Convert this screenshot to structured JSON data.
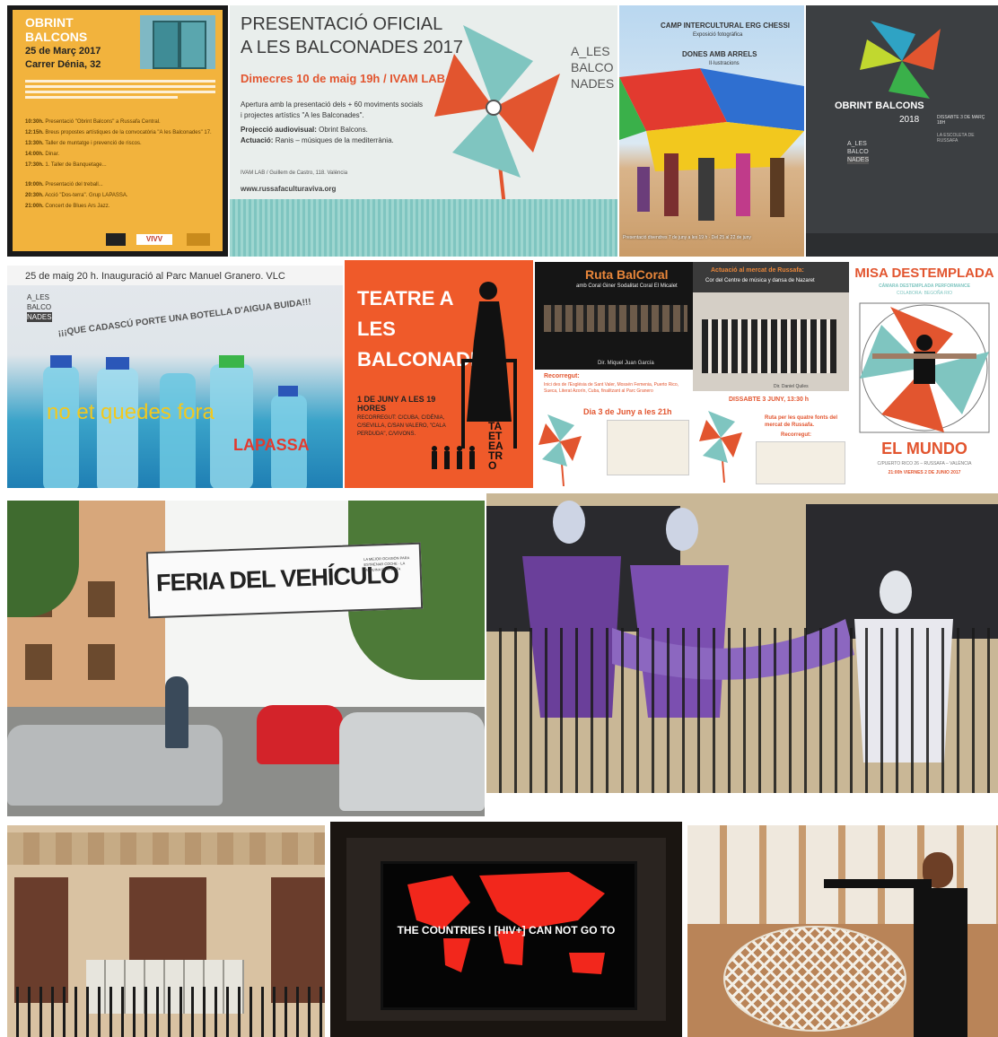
{
  "poster1": {
    "title": "OBRINT BALCONS",
    "date": "25 de Març 2017",
    "address": "Carrer Dénia, 32",
    "schedule": [
      {
        "time": "10:30h.",
        "text": "Presentació \"Obrint Balcons\" a Russafa Central."
      },
      {
        "time": "12:15h.",
        "text": "Breus propostes artístiques de la convocatòria \"A les Balconades\" 17."
      },
      {
        "time": "13:30h.",
        "text": "Taller de muntatge i prevenció de riscos."
      },
      {
        "time": "14:00h.",
        "text": "Dinar."
      },
      {
        "time": "17:30h.",
        "text": "1. Taller de Banquetage..."
      },
      {
        "time": "19:00h.",
        "text": "Presentació del treball..."
      },
      {
        "time": "20:30h.",
        "text": "Acció \"Dos-terra\". Grup LAPASSA."
      },
      {
        "time": "21:00h.",
        "text": "Concert de Blues Ars Jazz."
      }
    ],
    "logo_a": "VIVV"
  },
  "poster2": {
    "title_line1": "PRESENTACIÓ OFICIAL",
    "title_line2": "A LES BALCONADES 2017",
    "date_line": "Dimecres 10 de maig 19h / IVAM LAB",
    "body1": "Apertura amb la presentació dels + 60 moviments socials",
    "body2": "i projectes artístics \"A les Balconades\".",
    "proj_label": "Projecció audiovisual:",
    "proj_value": "Obrint Balcons.",
    "act_label": "Actuació:",
    "act_value": "Ranis – músiques de la mediterrània.",
    "venue": "IVAM LAB / Guillem de Castro, 118. València",
    "url": "www.russafaculturaviva.org",
    "brand": [
      "A_LES",
      "BALCO",
      "NADES"
    ]
  },
  "poster3": {
    "title": "CAMP INTERCULTURAL ERG CHESSI",
    "subtitle": "Exposició fotogràfica",
    "title2": "DONES AMB ARRELS",
    "subtitle2": "Il·lustracions",
    "footer": "Presentació divendres 7 de juny a les 19 h · Del 25 al 22 de juny"
  },
  "poster4": {
    "title": "OBRINT BALCONS",
    "year": "2018",
    "brand": [
      "A_LES",
      "BALCO",
      "NADES"
    ],
    "info": "DISSABTE 3 DE MARÇ 18H",
    "place": "LA ESCOLETA DE RUSSAFA"
  },
  "poster5": {
    "header": "25 de maig 20 h. Inauguració al Parc Manuel Granero. VLC",
    "brand": [
      "A_LES",
      "BALCO",
      "NADES"
    ],
    "slogan": "¡¡¡QUE CADASCÚ PORTE UNA BOTELLA D'AIGUA BUIDA!!!",
    "big": "no et quedes fora",
    "group": "LAPASSA"
  },
  "poster6": {
    "title": "TEATRE A LES BALCONADES",
    "date": "1 DE JUNY A LES 19 HORES",
    "route": "RECORREGUT: C/CUBA, C/DÉNIA, C/SEVILLA, C/SAN VALERO, \"CALA PERDUDA\", C/VIVONS.",
    "logo": "TAETEATRO"
  },
  "poster7": {
    "title": "Ruta BalCoral",
    "subtitle": "amb Coral Giner Sodalitat Coral El Micalet",
    "director": "Dir. Miquel Juan García",
    "route_label": "Recorregut:",
    "route_text": "Inici des de l'Església de Sant Valer, Mossén Femenia, Puerto Rico, Sueca, Literat Azorín, Cuba, finalitzant al Parc Granero",
    "date": "Dia 3 de Juny a les 21h"
  },
  "poster8": {
    "title": "Actuació al mercat de Russafa:",
    "subtitle": "Cor del Centre de música y dansa de Nazaret",
    "director": "Dir. Daniel Quiles",
    "date": "DISSABTE 3 JUNY, 13:30 h",
    "route": "Ruta per les quatre fonts del mercat de Russafa.",
    "route_label": "Recorregut:"
  },
  "poster9": {
    "title": "MISA DESTEMPLADA",
    "subtitle": "CÁMARA DESTEMPLADA PERFORMANCE",
    "collab": "COLABORA: BEGOÑA RIO",
    "bottom": "EL MUNDO",
    "address": "C/PUERTO RICO 26 – RUSSAFA – VALÈNCIA",
    "date": "21:00h VIERNES 2 DE JUNIO 2017"
  },
  "photo_banner": {
    "text": "FERIA DEL VEHÍCULO",
    "small": "LA MEJOR OCASIÓN PARA ESTRENAR COCHE · LA MÁQUINA PERFECTA"
  },
  "photo_screen": {
    "text": "THE COUNTRIES I [HIV+] CAN NOT GO TO"
  },
  "colors": {
    "orange": "#e2552f",
    "teal": "#7fc5c0",
    "yellow": "#f2b33d",
    "dark_grey": "#3c3f42"
  }
}
